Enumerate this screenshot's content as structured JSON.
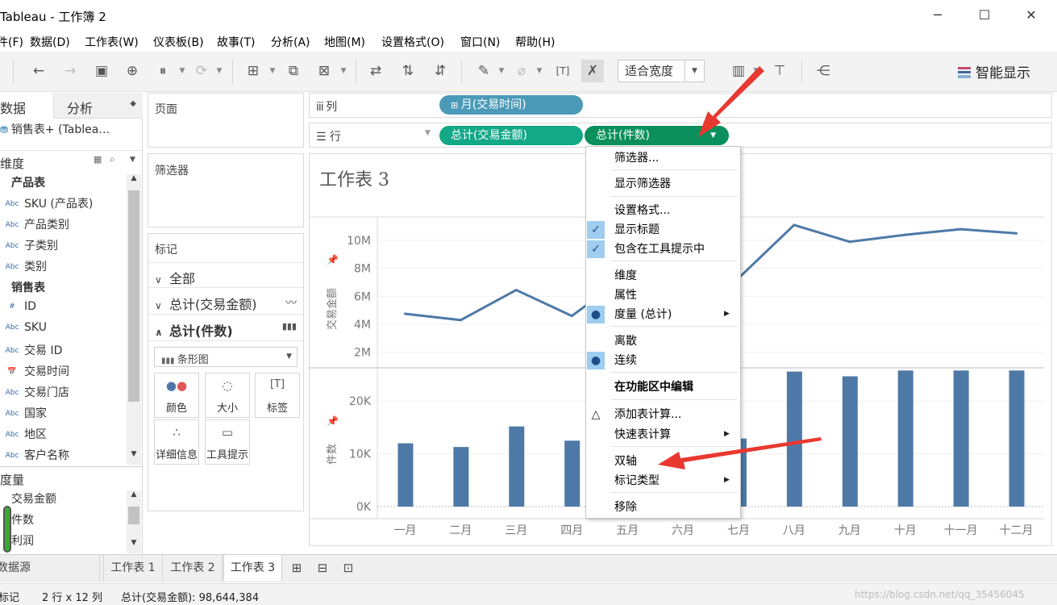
{
  "window": {
    "title": "Tableau - 工作簿 2",
    "min": "─",
    "max": "☐",
    "close": "✕"
  },
  "menu": [
    "件(F)",
    "数据(D)",
    "工作表(W)",
    "仪表板(B)",
    "故事(T)",
    "分析(A)",
    "地图(M)",
    "设置格式(O)",
    "窗口(N)",
    "帮助(H)"
  ],
  "toolbar": {
    "fit": "适合宽度",
    "show_me": "智能显示"
  },
  "datapane": {
    "tab_data": "数据",
    "tab_analysis": "分析",
    "datasource": "销售表+ (Tablea…",
    "dims_header": "维度",
    "dimensions": [
      {
        "type": "",
        "label": "产品表",
        "group": true
      },
      {
        "type": "Abc",
        "label": "SKU (产品表)"
      },
      {
        "type": "Abc",
        "label": "产品类别"
      },
      {
        "type": "Abc",
        "label": "子类别"
      },
      {
        "type": "Abc",
        "label": "类别"
      },
      {
        "type": "",
        "label": "销售表",
        "group": true
      },
      {
        "type": "#",
        "label": "ID"
      },
      {
        "type": "Abc",
        "label": "SKU"
      },
      {
        "type": "Abc",
        "label": "交易 ID"
      },
      {
        "type": "📅",
        "label": "交易时间"
      },
      {
        "type": "Abc",
        "label": "交易门店"
      },
      {
        "type": "Abc",
        "label": "国家"
      },
      {
        "type": "Abc",
        "label": "地区"
      },
      {
        "type": "Abc",
        "label": "客户名称"
      }
    ],
    "measures_header": "度量",
    "measures": [
      "交易金额",
      "件数",
      "利润"
    ]
  },
  "cards": {
    "pages": "页面",
    "filters": "筛选器",
    "marks": "标记",
    "marks_all": "全部",
    "marks_amount": "总计(交易金额)",
    "marks_count": "总计(件数)",
    "mark_type": "条形图",
    "buttons": {
      "color": "颜色",
      "size": "大小",
      "label": "标签",
      "detail": "详细信息",
      "tooltip": "工具提示"
    }
  },
  "shelves": {
    "columns_label": "列",
    "rows_label": "行",
    "column_pill": "月(交易时间)",
    "row_pill_1": "总计(交易金额)",
    "row_pill_2": "总计(件数)"
  },
  "sheet": {
    "title": "工作表 3"
  },
  "chart_data": [
    {
      "type": "line",
      "ylabel": "交易金额",
      "x": [
        "一月",
        "二月",
        "三月",
        "四月",
        "五月",
        "六月",
        "七月",
        "八月",
        "九月",
        "十月",
        "十一月",
        "十二月"
      ],
      "values": [
        4.75,
        4.3,
        6.45,
        4.6,
        7.5,
        null,
        7.3,
        11.1,
        9.9,
        10.4,
        10.8,
        10.5
      ],
      "unit": "M",
      "ylim": [
        1,
        11.5
      ],
      "yticks": [
        "2M",
        "4M",
        "6M",
        "8M",
        "10M"
      ],
      "color": "#4e79a7"
    },
    {
      "type": "bar",
      "ylabel": "件数",
      "categories": [
        "一月",
        "二月",
        "三月",
        "四月",
        "五月",
        "六月",
        "七月",
        "八月",
        "九月",
        "十月",
        "十一月",
        "十二月"
      ],
      "values": [
        12000,
        11300,
        15200,
        12500,
        null,
        null,
        12900,
        25600,
        24700,
        25800,
        25800,
        25800
      ],
      "ylim": [
        0,
        26000
      ],
      "yticks": [
        "0K",
        "10K",
        "20K"
      ],
      "color": "#4e79a7"
    }
  ],
  "context_menu": [
    {
      "label": "筛选器...",
      "check": "",
      "sub": false,
      "bold": false
    },
    {
      "label": "显示筛选器",
      "check": "",
      "sub": false,
      "bold": false
    },
    {
      "label": "设置格式...",
      "check": "",
      "sub": false,
      "bold": false
    },
    {
      "label": "显示标题",
      "check": "✓",
      "sub": false,
      "bold": false
    },
    {
      "label": "包含在工具提示中",
      "check": "✓",
      "sub": false,
      "bold": false
    },
    {
      "label": "维度",
      "check": "",
      "sub": false,
      "bold": false
    },
    {
      "label": "属性",
      "check": "",
      "sub": false,
      "bold": false
    },
    {
      "label": "度量 (总计)",
      "check": "●",
      "sub": true,
      "bold": false
    },
    {
      "label": "离散",
      "check": "",
      "sub": false,
      "bold": false
    },
    {
      "label": "连续",
      "check": "●",
      "sub": false,
      "bold": false
    },
    {
      "label": "在功能区中编辑",
      "check": "",
      "sub": false,
      "bold": true
    },
    {
      "label": "添加表计算...",
      "check": "△",
      "sub": false,
      "bold": false
    },
    {
      "label": "快速表计算",
      "check": "",
      "sub": true,
      "bold": false
    },
    {
      "label": "双轴",
      "check": "",
      "sub": false,
      "bold": false
    },
    {
      "label": "标记类型",
      "check": "",
      "sub": true,
      "bold": false
    },
    {
      "label": "移除",
      "check": "",
      "sub": false,
      "bold": false
    }
  ],
  "tabs": {
    "datasource": "数据源",
    "sheets": [
      "工作表 1",
      "工作表 2",
      "工作表 3"
    ]
  },
  "status": {
    "marks": "标记",
    "dims": "2 行 x 12 列",
    "sum": "总计(交易金额): 98,644,384",
    "watermark": "https://blog.csdn.net/qq_35456045"
  }
}
